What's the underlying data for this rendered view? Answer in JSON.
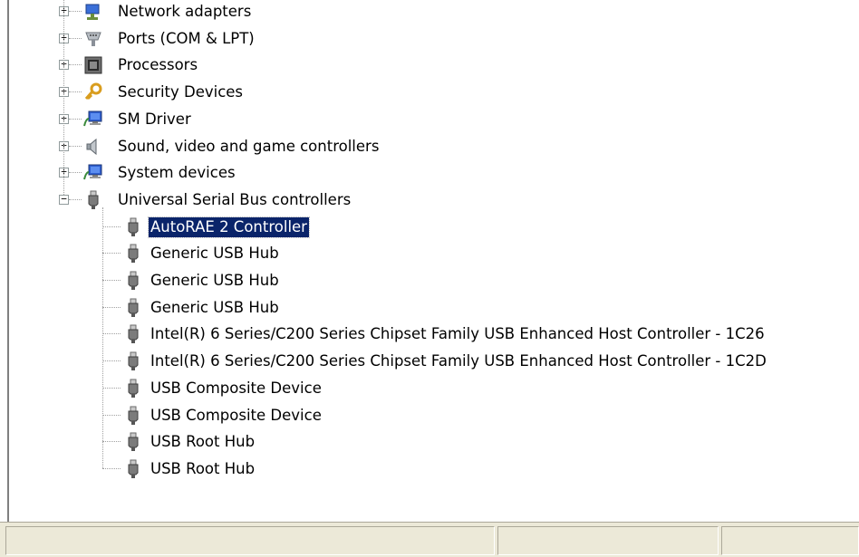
{
  "tree": {
    "categories": [
      {
        "label": "Network adapters",
        "icon": "network-adapter-icon",
        "expanded": false
      },
      {
        "label": "Ports (COM & LPT)",
        "icon": "port-icon",
        "expanded": false
      },
      {
        "label": "Processors",
        "icon": "processor-icon",
        "expanded": false
      },
      {
        "label": "Security Devices",
        "icon": "key-icon",
        "expanded": false
      },
      {
        "label": "SM Driver",
        "icon": "computer-icon",
        "expanded": false
      },
      {
        "label": "Sound, video and game controllers",
        "icon": "speaker-icon",
        "expanded": false
      },
      {
        "label": "System devices",
        "icon": "computer-icon",
        "expanded": false
      },
      {
        "label": "Universal Serial Bus controllers",
        "icon": "usb-plug-icon",
        "expanded": true
      }
    ],
    "usb_children": [
      {
        "label": "AutoRAE 2 Controller",
        "selected": true
      },
      {
        "label": "Generic USB Hub",
        "selected": false
      },
      {
        "label": "Generic USB Hub",
        "selected": false
      },
      {
        "label": "Generic USB Hub",
        "selected": false
      },
      {
        "label": "Intel(R) 6 Series/C200 Series Chipset Family USB Enhanced Host Controller - 1C26",
        "selected": false
      },
      {
        "label": "Intel(R) 6 Series/C200 Series Chipset Family USB Enhanced Host Controller - 1C2D",
        "selected": false
      },
      {
        "label": "USB Composite Device",
        "selected": false
      },
      {
        "label": "USB Composite Device",
        "selected": false
      },
      {
        "label": "USB Root Hub",
        "selected": false
      },
      {
        "label": "USB Root Hub",
        "selected": false
      }
    ],
    "expand_glyph": "+",
    "collapse_glyph": "−"
  },
  "statusbar": {
    "panes": [
      "",
      "",
      ""
    ]
  },
  "colors": {
    "selection_bg": "#0a246a",
    "selection_fg": "#ffffff",
    "statusbar_bg": "#ece9d8"
  }
}
